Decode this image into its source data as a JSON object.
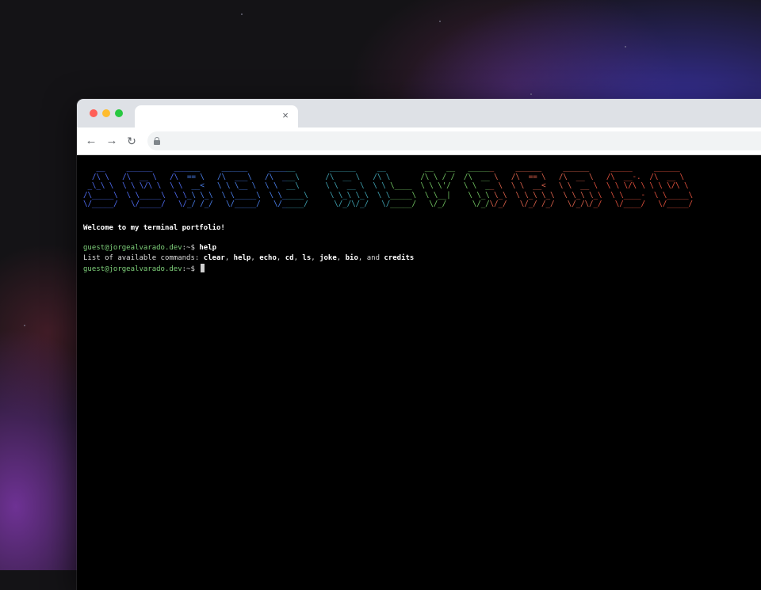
{
  "browser": {
    "tab_close": "×",
    "back_icon": "←",
    "forward_icon": "→",
    "reload_icon": "↻"
  },
  "terminal": {
    "banner": {
      "rows": [
        "   __     ______     ______     ______     ______        ______     __         __   __   ______     ______     ______     _____     ______   ",
        "  /\\ \\   /\\  __ \\   /\\  == \\   /\\  ___\\   /\\  ___\\      /\\  __ \\   /\\ \\       /\\ \\ / /  /\\  __ \\   /\\  == \\   /\\  __ \\   /\\  __-.  /\\  __ \\  ",
        " _\\_\\ \\  \\ \\ \\/\\ \\  \\ \\  __<   \\ \\ \\__ \\  \\ \\  __\\      \\ \\  __ \\  \\ \\ \\____  \\ \\ \\'/   \\ \\  __ \\  \\ \\  __<   \\ \\  __ \\  \\ \\ \\/\\ \\ \\ \\ \\/\\ \\ ",
        "/\\_____\\  \\ \\_____\\  \\ \\_\\ \\_\\  \\ \\_____\\  \\ \\_____\\     \\ \\_\\ \\_\\  \\ \\_____\\  \\ \\__|    \\ \\_\\ \\_\\  \\ \\_\\ \\_\\  \\ \\_\\ \\_\\  \\ \\____-  \\ \\_____\\",
        "\\/_____/   \\/_____/   \\/_/ /_/   \\/_____/   \\/_____/      \\/_/\\/_/   \\/_____/   \\/_/      \\/_/\\/_/   \\/_/ /_/   \\/_/\\/_/   \\/____/   \\/_____/"
      ],
      "colors": [
        "#4f6cf0",
        "#4a7ee8",
        "#3fa0b0",
        "#70c060",
        "#d9604a",
        "#e0503c"
      ]
    },
    "welcome": "Welcome to my terminal portfolio!",
    "prompt": {
      "user": "guest@jorgealvarado.dev",
      "symbol": ":~$ "
    },
    "history": [
      {
        "command": "help",
        "output_prefix": "List of available commands: ",
        "commands_list": [
          "clear",
          "help",
          "echo",
          "cd",
          "ls",
          "joke",
          "bio",
          "credits"
        ],
        "separator": ", ",
        "last_join": ", and "
      }
    ]
  }
}
